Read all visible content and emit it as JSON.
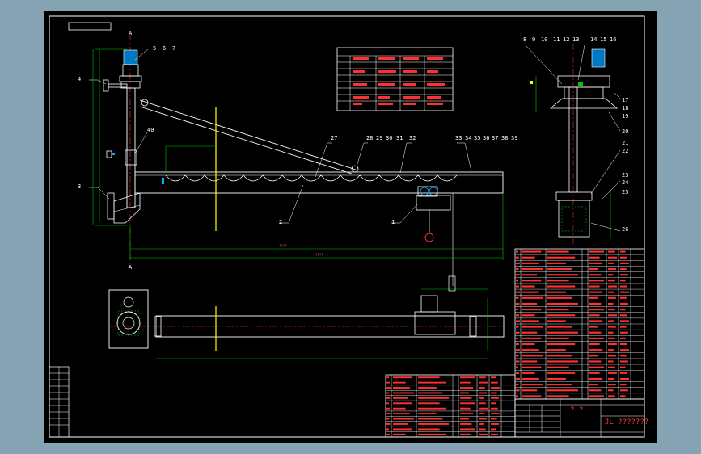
{
  "drawing": {
    "title_block_text": "JL ???????",
    "scale_text": "? ?",
    "section_marker": "A",
    "part_labels": {
      "p1": "1",
      "p2": "2",
      "p3": "3",
      "p4": "4",
      "p5": "5",
      "p6": "6",
      "p7": "7",
      "p8": "8",
      "p9": "9",
      "p10": "10",
      "p11": "11",
      "p12": "12",
      "p13": "13",
      "p14": "14",
      "p15": "15",
      "p16": "16",
      "p17": "17",
      "p18": "18",
      "p19": "19",
      "p20": "20",
      "p21": "21",
      "p22": "22",
      "p23": "23",
      "p24": "24",
      "p25": "25",
      "p26": "26",
      "p27": "27",
      "p28": "28",
      "p29": "29",
      "p30": "30",
      "p31": "31",
      "p32": "32",
      "p33": "33",
      "p34": "34",
      "p35": "35",
      "p36": "36",
      "p37": "37",
      "p38": "38",
      "p39": "39",
      "p40": "40"
    }
  },
  "colors": {
    "frame": "#ffffff",
    "object": "#ffffff",
    "dimension": "#00c800",
    "center_line": "#ff3030",
    "leader": "#ffffff",
    "highlight": "#ffff00",
    "table_grid": "#ffffff",
    "table_text": "#ff3030",
    "equipment_accent": "#00b4ff"
  }
}
